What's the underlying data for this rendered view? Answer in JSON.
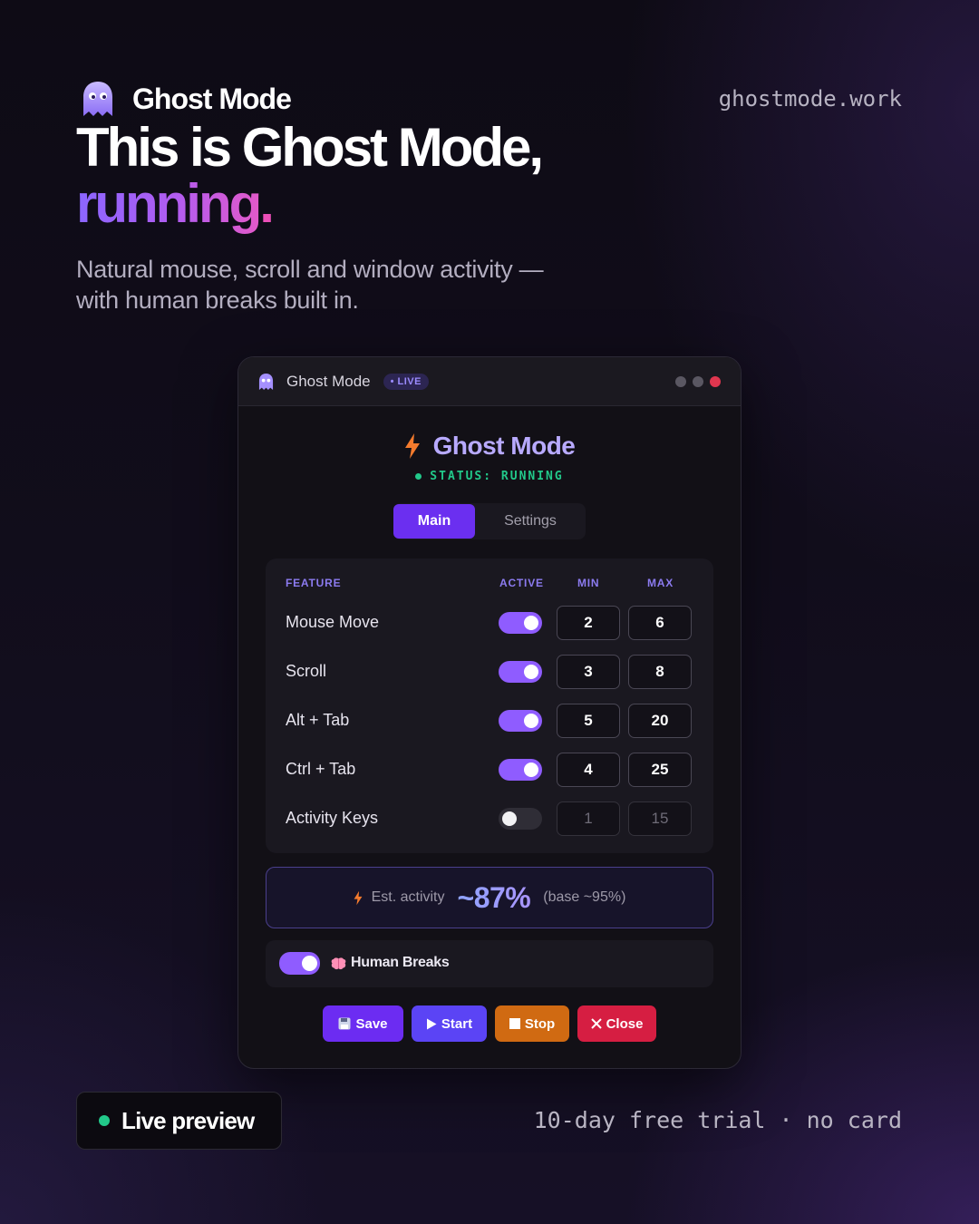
{
  "brand": {
    "name": "Ghost Mode",
    "url": "ghostmode.work"
  },
  "headline": {
    "line1": "This is Ghost Mode,",
    "line2_word": "running",
    "line2_punct": "."
  },
  "subtitle": "Natural mouse, scroll and window activity — with human breaks built in.",
  "window": {
    "title": "Ghost Mode",
    "badge": "• LIVE",
    "app_title": "Ghost Mode",
    "status": "STATUS: RUNNING",
    "tabs": [
      {
        "label": "Main",
        "active": true
      },
      {
        "label": "Settings",
        "active": false
      }
    ],
    "columns": {
      "feature": "FEATURE",
      "active": "ACTIVE",
      "min": "MIN",
      "max": "MAX"
    },
    "features": [
      {
        "name": "Mouse Move",
        "active": true,
        "min": "2",
        "max": "6"
      },
      {
        "name": "Scroll",
        "active": true,
        "min": "3",
        "max": "8"
      },
      {
        "name": "Alt + Tab",
        "active": true,
        "min": "5",
        "max": "20"
      },
      {
        "name": "Ctrl + Tab",
        "active": true,
        "min": "4",
        "max": "25"
      },
      {
        "name": "Activity Keys",
        "active": false,
        "min": "1",
        "max": "15"
      }
    ],
    "estimate": {
      "label": "Est. activity",
      "value": "~87%",
      "base": "(base ~95%)"
    },
    "human_breaks": {
      "label": "Human Breaks",
      "active": true
    },
    "actions": {
      "save": "Save",
      "start": "Start",
      "stop": "Stop",
      "close": "Close"
    }
  },
  "footer": {
    "live_preview": "Live preview",
    "trial": "10-day free trial · no card"
  },
  "colors": {
    "accent": "#6b2ff0",
    "toggle_on": "#8f5cff",
    "status_green": "#22c98a",
    "stop": "#d06a12",
    "close": "#d61e42"
  }
}
